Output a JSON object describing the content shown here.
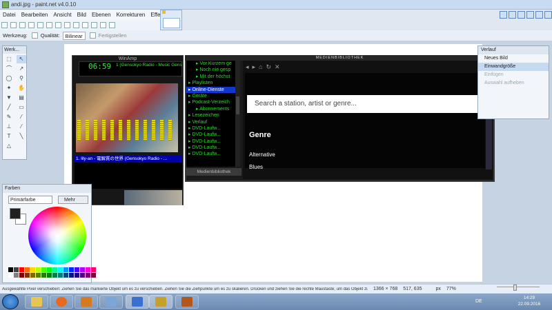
{
  "window": {
    "title": "andi.jpg - paint.net v4.0.10"
  },
  "menu": [
    "Datei",
    "Bearbeiten",
    "Ansicht",
    "Bild",
    "Ebenen",
    "Korrekturen",
    "Effekte"
  ],
  "toolbar2": {
    "tool_label": "Werkzeug:",
    "quality_label": "Qualität:",
    "quality_value": "Bilinear",
    "finish_label": "Fertigstellen"
  },
  "tools_window": {
    "title": "Werk..."
  },
  "history": {
    "title": "Verlauf",
    "items": [
      {
        "label": "Neues Bild",
        "state": "normal"
      },
      {
        "label": "Einwandgröße",
        "state": "selected"
      },
      {
        "label": "Einfügen",
        "state": "dim"
      },
      {
        "label": "Auswahl aufheben",
        "state": "dim"
      }
    ]
  },
  "colors_window": {
    "title": "Farben",
    "primary_select": "Primärfarbe",
    "more_button": "Mehr",
    "primary_color": "#202020",
    "secondary_color": "#ffffff"
  },
  "winamp": {
    "title": "WinAmp",
    "time": "06:59",
    "track_display": "1 (Gensokyo Radio - Music Gens",
    "playlist_item": "1. lily-an - 電解質の世界 (Gensokyo Radio - ..."
  },
  "media_library": {
    "title": "MEDIENBIBLIOTHEK",
    "tree": [
      {
        "label": "Vor Kurzem ge",
        "state": "normal"
      },
      {
        "label": "Noch nie gesp",
        "state": "normal"
      },
      {
        "label": "Mit der höchst",
        "state": "normal"
      },
      {
        "label": "Playlisten",
        "state": "normal"
      },
      {
        "label": "Online-Dienste",
        "state": "selected"
      },
      {
        "label": "Geräte",
        "state": "normal"
      },
      {
        "label": "Podcast-Verzeich",
        "state": "normal"
      },
      {
        "label": "Abonnements",
        "state": "normal"
      },
      {
        "label": "Lesezeichen",
        "state": "normal"
      },
      {
        "label": "Verlauf",
        "state": "normal"
      },
      {
        "label": "DVD-Laufw...",
        "state": "normal"
      },
      {
        "label": "DVD-Laufw...",
        "state": "normal"
      },
      {
        "label": "DVD-Laufw...",
        "state": "normal"
      },
      {
        "label": "DVD-Laufw...",
        "state": "normal"
      },
      {
        "label": "DVD-Laufw...",
        "state": "normal"
      }
    ],
    "library_button": "Medienbibliothek",
    "search_placeholder": "Search a station, artist or genre...",
    "genre_heading": "Genre",
    "genres": [
      "Alternative",
      "Blues"
    ]
  },
  "status": {
    "message": "Ausgewählte Pixel verschieben: Ziehen Sie das markierte Objekt um es zu verschieben. Ziehen Sie die Ziehpunkte um es zu skalieren. Drücken und ziehen Sie die rechte Maustaste, um das Objekt zu drehen.",
    "image_size": "1366 × 768",
    "cursor_pos": "517, 635",
    "unit": "px",
    "zoom": "77%"
  },
  "taskbar": {
    "language": "DE",
    "time": "14:29",
    "date": "22.09.2016"
  }
}
